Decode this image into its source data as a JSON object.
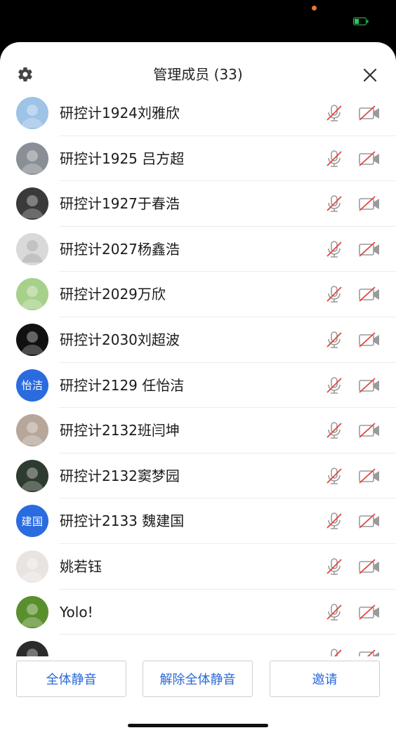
{
  "header": {
    "title": "管理成员 (33)",
    "settings_icon": "gear-icon",
    "close_icon": "close-icon"
  },
  "members": [
    {
      "name": "研控计1924刘雅欣",
      "avatar": {
        "type": "photo",
        "bg": "#9dc3e6"
      }
    },
    {
      "name": "研控计1925 吕方超",
      "avatar": {
        "type": "photo",
        "bg": "#8a8f96"
      }
    },
    {
      "name": "研控计1927于春浩",
      "avatar": {
        "type": "photo",
        "bg": "#3a3a3a"
      }
    },
    {
      "name": "研控计2027杨鑫浩",
      "avatar": {
        "type": "default",
        "bg": "#d9d9d9"
      }
    },
    {
      "name": "研控计2029万欣",
      "avatar": {
        "type": "photo",
        "bg": "#a7d08a"
      }
    },
    {
      "name": "研控计2030刘超波",
      "avatar": {
        "type": "photo",
        "bg": "#111111"
      }
    },
    {
      "name": "研控计2129 任怡洁",
      "avatar": {
        "type": "text",
        "text": "怡洁",
        "bg": "#2a6be0"
      }
    },
    {
      "name": "研控计2132班闫坤",
      "avatar": {
        "type": "photo",
        "bg": "#b7a79a"
      }
    },
    {
      "name": "研控计2132窦梦园",
      "avatar": {
        "type": "photo",
        "bg": "#2e3b2f"
      }
    },
    {
      "name": "研控计2133 魏建国",
      "avatar": {
        "type": "text",
        "text": "建国",
        "bg": "#2a6be0"
      }
    },
    {
      "name": "姚若钰",
      "avatar": {
        "type": "photo",
        "bg": "#e9e4e2"
      }
    },
    {
      "name": "Yolo!",
      "avatar": {
        "type": "photo",
        "bg": "#5a8f2d"
      }
    },
    {
      "name": "",
      "avatar": {
        "type": "photo",
        "bg": "#2b2b2b"
      }
    }
  ],
  "icons": {
    "mic": "mic-muted-icon",
    "camera": "camera-off-icon"
  },
  "colors": {
    "muted_red": "#e0463c",
    "icon_gray": "#9a9a9a",
    "accent": "#2a68d8"
  },
  "footer": {
    "mute_all": "全体静音",
    "unmute_all": "解除全体静音",
    "invite": "邀请"
  }
}
